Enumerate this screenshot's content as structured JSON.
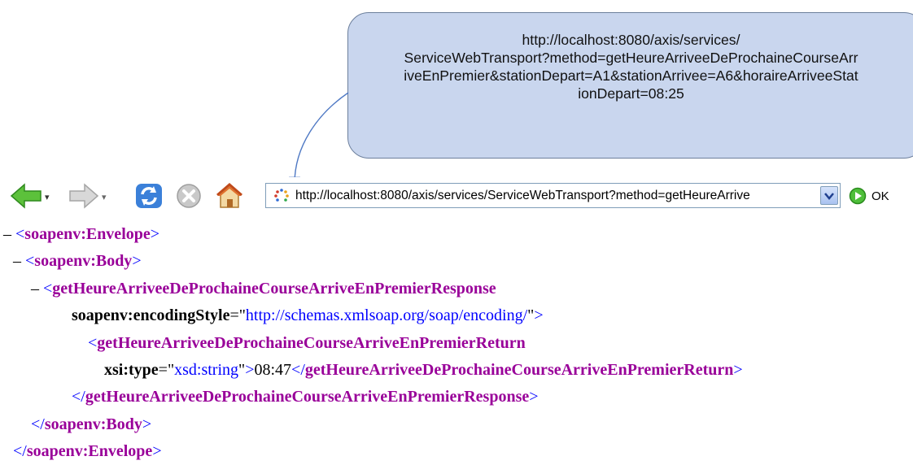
{
  "callout": {
    "lines": [
      "http://localhost:8080/axis/services/",
      "ServiceWebTransport?method=getHeureArriveeDeProchaineCourseArr",
      "iveEnPremier&stationDepart=A1&stationArrivee=A6&horaireArriveeStat",
      "ionDepart=08:25"
    ]
  },
  "toolbar": {
    "back_icon": "back-arrow-icon",
    "forward_icon": "forward-arrow-icon",
    "refresh_icon": "refresh-icon",
    "stop_icon": "stop-icon",
    "home_icon": "home-icon",
    "address": "http://localhost:8080/axis/services/ServiceWebTransport?method=getHeureArrive",
    "go_label": "OK"
  },
  "xml": {
    "minus": "–",
    "envelope_tag": "soapenv:Envelope",
    "body_tag": "soapenv:Body",
    "response_tag": "getHeureArriveeDeProchaineCourseArriveEnPremierResponse",
    "encoding_attr": "soapenv:encodingStyle",
    "encoding_value": "http://schemas.xmlsoap.org/soap/encoding/",
    "return_tag": "getHeureArriveeDeProchaineCourseArriveEnPremierReturn",
    "type_attr": "xsi:type",
    "type_value": "xsd:string",
    "return_value": "08:47"
  },
  "colors": {
    "tag": "#990099",
    "value": "#0000ff",
    "callout_fill": "#c9d6ee"
  }
}
